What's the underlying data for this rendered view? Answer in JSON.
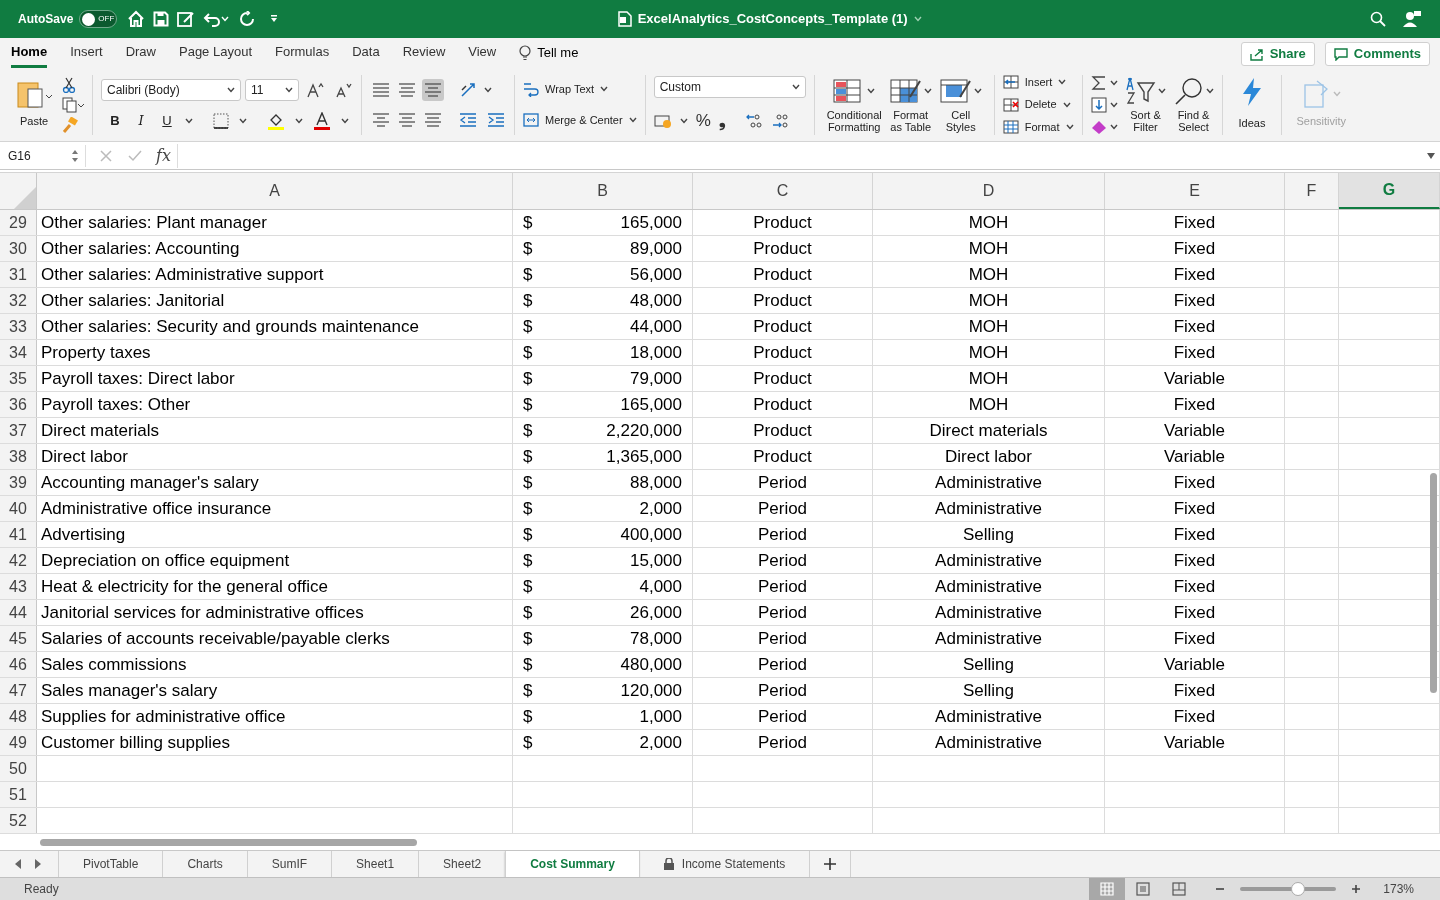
{
  "title_bar": {
    "autosave_label": "AutoSave",
    "autosave_toggle": {
      "label": "OFF",
      "on": false
    },
    "title": "ExcelAnalytics_CostConcepts_Template (1)"
  },
  "menu_tabs": [
    {
      "label": "Home",
      "selected": true
    },
    {
      "label": "Insert",
      "selected": false
    },
    {
      "label": "Draw",
      "selected": false
    },
    {
      "label": "Page Layout",
      "selected": false
    },
    {
      "label": "Formulas",
      "selected": false
    },
    {
      "label": "Data",
      "selected": false
    },
    {
      "label": "Review",
      "selected": false
    },
    {
      "label": "View",
      "selected": false
    }
  ],
  "tell_me": "Tell me",
  "share_button": "Share",
  "comments_button": "Comments",
  "ribbon": {
    "paste": "Paste",
    "font_name": "Calibri (Body)",
    "font_size": "11",
    "font_buttons": [
      "B",
      "I",
      "U"
    ],
    "wrap_text": "Wrap Text",
    "merge_center": "Merge & Center",
    "number_format": "Custom",
    "percent": "%",
    "comma": "❟",
    "big_buttons": [
      {
        "label": "Conditional\nFormatting",
        "kind": "conditional"
      },
      {
        "label": "Format\nas Table",
        "kind": "table"
      },
      {
        "label": "Cell\nStyles",
        "kind": "styles"
      }
    ],
    "cell_buttons": [
      {
        "label": "Insert",
        "kind": "insert"
      },
      {
        "label": "Delete",
        "kind": "delete"
      },
      {
        "label": "Format",
        "kind": "format"
      }
    ],
    "edit_buttons": [
      {
        "label": "Sort &\nFilter",
        "kind": "sort"
      },
      {
        "label": "Find &\nSelect",
        "kind": "find"
      }
    ],
    "ideas": "Ideas",
    "sensitivity": {
      "label": "Sensitivity",
      "disabled": true
    }
  },
  "formula_bar": {
    "name_box": "G16",
    "fx": "fx"
  },
  "columns": [
    {
      "label": "A",
      "selected": false
    },
    {
      "label": "B",
      "selected": false
    },
    {
      "label": "C",
      "selected": false
    },
    {
      "label": "D",
      "selected": false
    },
    {
      "label": "E",
      "selected": false
    },
    {
      "label": "F",
      "selected": false
    },
    {
      "label": "G",
      "selected": true
    }
  ],
  "rows": [
    {
      "number": "29",
      "cells": [
        "Other salaries: Plant manager",
        "$",
        "165,000",
        "Product",
        "MOH",
        "Fixed"
      ]
    },
    {
      "number": "30",
      "cells": [
        "Other salaries: Accounting",
        "$",
        "89,000",
        "Product",
        "MOH",
        "Fixed"
      ]
    },
    {
      "number": "31",
      "cells": [
        "Other salaries: Administrative support",
        "$",
        "56,000",
        "Product",
        "MOH",
        "Fixed"
      ]
    },
    {
      "number": "32",
      "cells": [
        "Other salaries: Janitorial",
        "$",
        "48,000",
        "Product",
        "MOH",
        "Fixed"
      ]
    },
    {
      "number": "33",
      "cells": [
        "Other salaries: Security and grounds maintenance",
        "$",
        "44,000",
        "Product",
        "MOH",
        "Fixed"
      ]
    },
    {
      "number": "34",
      "cells": [
        "Property taxes",
        "$",
        "18,000",
        "Product",
        "MOH",
        "Fixed"
      ]
    },
    {
      "number": "35",
      "cells": [
        "Payroll taxes: Direct labor",
        "$",
        "79,000",
        "Product",
        "MOH",
        "Variable"
      ]
    },
    {
      "number": "36",
      "cells": [
        "Payroll taxes: Other",
        "$",
        "165,000",
        "Product",
        "MOH",
        "Fixed"
      ]
    },
    {
      "number": "37",
      "cells": [
        "Direct materials",
        "$",
        "2,220,000",
        "Product",
        "Direct materials",
        "Variable"
      ]
    },
    {
      "number": "38",
      "cells": [
        "Direct labor",
        "$",
        "1,365,000",
        "Product",
        "Direct labor",
        "Variable"
      ]
    },
    {
      "number": "39",
      "cells": [
        "Accounting manager's salary",
        "$",
        "88,000",
        "Period",
        "Administrative",
        "Fixed"
      ]
    },
    {
      "number": "40",
      "cells": [
        "Administrative office insurance",
        "$",
        "2,000",
        "Period",
        "Administrative",
        "Fixed"
      ]
    },
    {
      "number": "41",
      "cells": [
        "Advertising",
        "$",
        "400,000",
        "Period",
        "Selling",
        "Fixed"
      ]
    },
    {
      "number": "42",
      "cells": [
        "Depreciation on office equipment",
        "$",
        "15,000",
        "Period",
        "Administrative",
        "Fixed"
      ]
    },
    {
      "number": "43",
      "cells": [
        "Heat & electricity for the general office",
        "$",
        "4,000",
        "Period",
        "Administrative",
        "Fixed"
      ]
    },
    {
      "number": "44",
      "cells": [
        "Janitorial services for administrative offices",
        "$",
        "26,000",
        "Period",
        "Administrative",
        "Fixed"
      ]
    },
    {
      "number": "45",
      "cells": [
        "Salaries of accounts receivable/payable clerks",
        "$",
        "78,000",
        "Period",
        "Administrative",
        "Fixed"
      ]
    },
    {
      "number": "46",
      "cells": [
        "Sales commissions",
        "$",
        "480,000",
        "Period",
        "Selling",
        "Variable"
      ]
    },
    {
      "number": "47",
      "cells": [
        "Sales manager's salary",
        "$",
        "120,000",
        "Period",
        "Selling",
        "Fixed"
      ]
    },
    {
      "number": "48",
      "cells": [
        "Supplies for administrative office",
        "$",
        "1,000",
        "Period",
        "Administrative",
        "Fixed"
      ]
    },
    {
      "number": "49",
      "cells": [
        "Customer billing supplies",
        "$",
        "2,000",
        "Period",
        "Administrative",
        "Variable"
      ]
    },
    {
      "number": "50",
      "cells": []
    },
    {
      "number": "51",
      "cells": []
    },
    {
      "number": "52",
      "cells": []
    }
  ],
  "sheet_tabs": [
    {
      "label": "PivotTable",
      "selected": false,
      "locked": false
    },
    {
      "label": "Charts",
      "selected": false,
      "locked": false
    },
    {
      "label": "SumIF",
      "selected": false,
      "locked": false
    },
    {
      "label": "Sheet1",
      "selected": false,
      "locked": false
    },
    {
      "label": "Sheet2",
      "selected": false,
      "locked": false
    },
    {
      "label": "Cost Summary",
      "selected": true,
      "locked": false
    },
    {
      "label": "Income Statements",
      "selected": false,
      "locked": true
    }
  ],
  "status_bar": {
    "status": "Ready",
    "views": [
      {
        "kind": "normal",
        "selected": true
      },
      {
        "kind": "page",
        "selected": false
      },
      {
        "kind": "break",
        "selected": false
      }
    ],
    "zoom": {
      "level": 0.6,
      "label": "173%"
    }
  }
}
